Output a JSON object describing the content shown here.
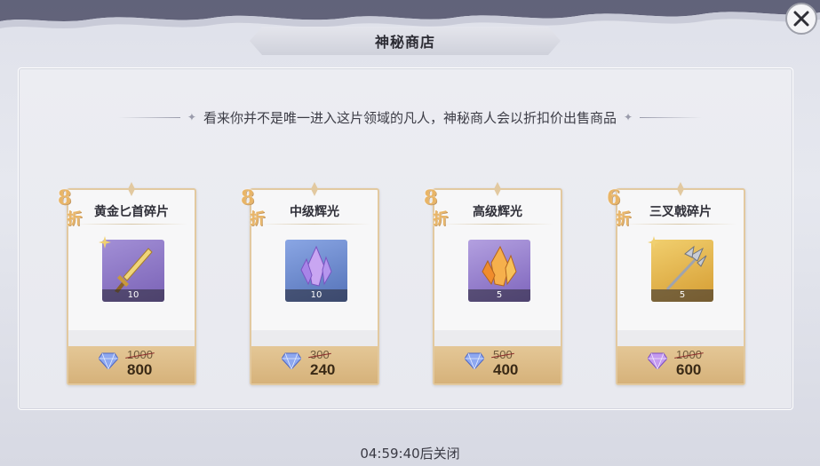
{
  "header": {
    "title": "神秘商店"
  },
  "close_button": {
    "icon": "close-icon"
  },
  "subtitle": "看来你并不是唯一进入这片领域的凡人，神秘商人会以折扣价出售商品",
  "currency_icon": "diamond-icon",
  "items": [
    {
      "name": "黄金匕首碎片",
      "discount_num": "8",
      "discount_char": "折",
      "quantity": "10",
      "old_price": "1000",
      "price": "800",
      "item_icon": "golden-dagger-icon",
      "bg": "#8c78c4"
    },
    {
      "name": "中级辉光",
      "discount_num": "8",
      "discount_char": "折",
      "quantity": "10",
      "old_price": "300",
      "price": "240",
      "item_icon": "purple-crystal-icon",
      "bg": "#6f8ccf"
    },
    {
      "name": "高级辉光",
      "discount_num": "8",
      "discount_char": "折",
      "quantity": "5",
      "old_price": "500",
      "price": "400",
      "item_icon": "orange-crystal-icon",
      "bg": "#9a7fc6"
    },
    {
      "name": "三叉戟碎片",
      "discount_num": "6",
      "discount_char": "折",
      "quantity": "5",
      "old_price": "1000",
      "price": "600",
      "item_icon": "trident-icon",
      "bg": "#e2b34c"
    }
  ],
  "footer": {
    "timer": "04:59:40后关闭"
  }
}
